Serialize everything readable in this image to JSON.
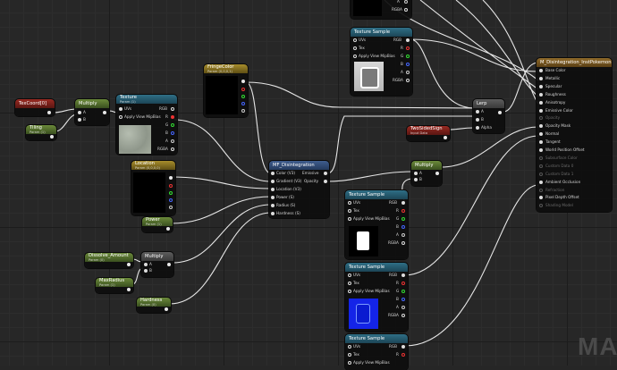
{
  "graph": {
    "texcoord": {
      "title": "TexCoord[0]"
    },
    "tiling": {
      "title": "Tiling",
      "subtitle": "Param (1)"
    },
    "multiply1": {
      "title": "Multiply",
      "pins": [
        "A",
        "B"
      ]
    },
    "texture_param": {
      "title": "Texture",
      "subtitle": "Param (1)",
      "pins": [
        "UVs",
        "Apply View MipBias"
      ],
      "outputs": [
        "RGB",
        "R",
        "G",
        "B",
        "A",
        "RGBA"
      ]
    },
    "fringe_color": {
      "title": "FringeColor",
      "subtitle": "Param (0,0,0,1)"
    },
    "location": {
      "title": "Location",
      "subtitle": "Param (0,0,0,0)"
    },
    "power": {
      "title": "Power",
      "subtitle": "Param (1)"
    },
    "dissolve_amount": {
      "title": "Dissolve_Amount",
      "subtitle": "Param (0)"
    },
    "max_radius": {
      "title": "MaxRadius",
      "subtitle": "Param (1)"
    },
    "multiply2": {
      "title": "Multiply",
      "pins": [
        "A",
        "B"
      ]
    },
    "hardness": {
      "title": "Hardness",
      "subtitle": "Param (0)"
    },
    "mf_disintegration": {
      "title": "MF_Disintegration",
      "inputs": [
        "Color (V3)",
        "Gradient (V3)",
        "Location (V3)",
        "Power (S)",
        "Radius (S)",
        "Hardness (S)"
      ],
      "outputs": [
        "Emissive",
        "Opacity"
      ]
    },
    "texture_sample_top": {
      "title": "Texture Sample",
      "pins": [
        "UVs",
        "Tex",
        "Apply View MipBias"
      ],
      "outputs": [
        "RGB",
        "R",
        "G",
        "B",
        "A",
        "RGBA"
      ]
    },
    "two_sided_sign": {
      "title": "TwoSidedSign",
      "subtitle": "Input Data"
    },
    "lerp": {
      "title": "Lerp",
      "pins": [
        "A",
        "B",
        "Alpha"
      ]
    },
    "multiply3": {
      "title": "Multiply",
      "pins": [
        "A",
        "B"
      ]
    },
    "texture_sample_mid": {
      "title": "Texture Sample",
      "pins": [
        "UVs",
        "Tex",
        "Apply View MipBias"
      ],
      "outputs": [
        "RGB",
        "R",
        "G",
        "B",
        "A",
        "RGBA"
      ]
    },
    "texture_sample_blue": {
      "title": "Texture Sample",
      "pins": [
        "UVs",
        "Tex",
        "Apply View MipBias"
      ],
      "outputs": [
        "RGB",
        "R",
        "G",
        "B",
        "A",
        "RGBA"
      ]
    },
    "texture_sample_bottom": {
      "title": "Texture Sample",
      "pins": [
        "UVs",
        "Tex",
        "Apply View MipBias"
      ],
      "outputs": [
        "RGB",
        "R"
      ]
    },
    "top_partial": {
      "outputs": [
        "A",
        "RGBA"
      ]
    },
    "material_result": {
      "title": "M_Disintegration_InstPokemon",
      "pins": [
        "Base Color",
        "Metallic",
        "Specular",
        "Roughness",
        "Anisotropy",
        "Emissive Color",
        "Opacity",
        "Opacity Mask",
        "Normal",
        "Tangent",
        "World Position Offset",
        "Subsurface Color",
        "Custom Data 0",
        "Custom Data 1",
        "Ambient Occlusion",
        "Refraction",
        "Pixel Depth Offset",
        "Shading Model"
      ],
      "dim_pins": [
        6,
        11,
        12,
        13,
        15,
        17
      ]
    }
  },
  "watermark": "MA",
  "colors": {
    "wire": "#e6e6e6",
    "red_header": "#9a2a22",
    "green_header": "#6b8a3a",
    "teal_header": "#2f6f86",
    "olive_header": "#a78d2c"
  }
}
